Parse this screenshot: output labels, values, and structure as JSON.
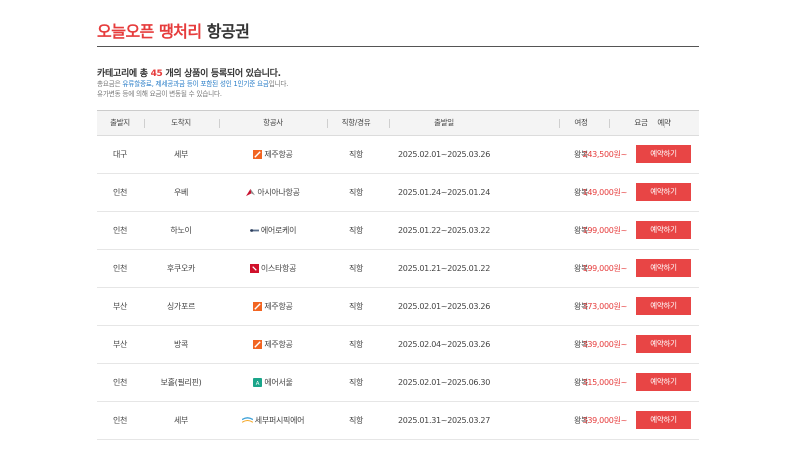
{
  "page": {
    "title_highlight": "오늘오픈 땡처리",
    "title_rest": " 항공권",
    "summary_prefix": "카테고리에 총 ",
    "summary_count": "45",
    "summary_suffix": " 개의 상품이 등록되어 있습니다.",
    "note1_prefix": "총요금은 ",
    "note1_highlight": "유류할증료, 제세공과금 등이 포함된 성인 1인기준 요금",
    "note1_suffix": "입니다.",
    "note2": "유가변동 등에 의해 요금이 변동될 수 있습니다."
  },
  "colors": {
    "accent": "#e63c3c",
    "button": "#e84545",
    "note_blue": "#2a7ec8"
  },
  "table": {
    "headers": [
      "출발지",
      "도착지",
      "항공사",
      "직항/경유",
      "출발일",
      "여정",
      "요금",
      "예약"
    ],
    "book_label": "예약하기",
    "rows": [
      {
        "from": "대구",
        "to": "세부",
        "airline": "제주항공",
        "logo": "jeju-air-icon",
        "stop": "직항",
        "dates": "2025.02.01~2025.03.26",
        "trip": "왕복",
        "price": "243,500원~"
      },
      {
        "from": "인천",
        "to": "우베",
        "airline": "아시아나항공",
        "logo": "asiana-icon",
        "stop": "직항",
        "dates": "2025.01.24~2025.01.24",
        "trip": "왕복",
        "price": "149,000원~"
      },
      {
        "from": "인천",
        "to": "하노이",
        "airline": "에어로케이",
        "logo": "aerok-icon",
        "stop": "직항",
        "dates": "2025.01.22~2025.03.22",
        "trip": "왕복",
        "price": "199,000원~"
      },
      {
        "from": "인천",
        "to": "후쿠오카",
        "airline": "이스타항공",
        "logo": "eastar-icon",
        "stop": "직항",
        "dates": "2025.01.21~2025.01.22",
        "trip": "왕복",
        "price": "199,000원~"
      },
      {
        "from": "부산",
        "to": "싱가포르",
        "airline": "제주항공",
        "logo": "jeju-air-icon",
        "stop": "직항",
        "dates": "2025.02.01~2025.03.26",
        "trip": "왕복",
        "price": "373,000원~"
      },
      {
        "from": "부산",
        "to": "방콕",
        "airline": "제주항공",
        "logo": "jeju-air-icon",
        "stop": "직항",
        "dates": "2025.02.04~2025.03.26",
        "trip": "왕복",
        "price": "339,000원~"
      },
      {
        "from": "인천",
        "to": "보홀(필리핀)",
        "airline": "에어서울",
        "logo": "air-seoul-icon",
        "stop": "직항",
        "dates": "2025.02.01~2025.06.30",
        "trip": "왕복",
        "price": "315,000원~"
      },
      {
        "from": "인천",
        "to": "세부",
        "airline": "세부퍼시픽에어",
        "logo": "cebu-pacific-icon",
        "stop": "직항",
        "dates": "2025.01.31~2025.03.27",
        "trip": "왕복",
        "price": "339,000원~"
      }
    ]
  }
}
